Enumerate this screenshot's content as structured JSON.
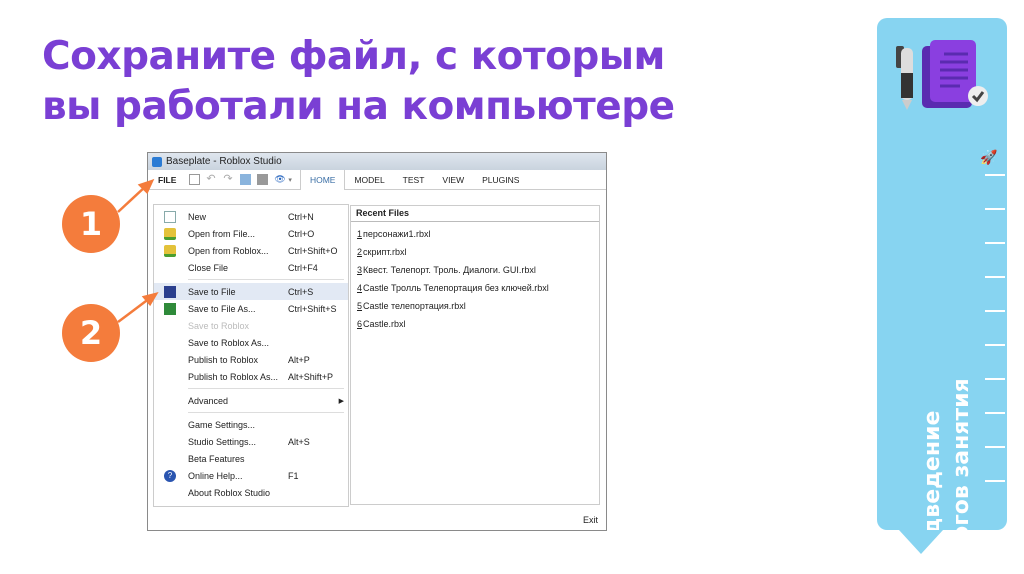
{
  "slide": {
    "title_line1": "Сохраните файл, с которым",
    "title_line2": "вы работали на компьютере",
    "step1": "1",
    "step2": "2"
  },
  "window": {
    "title": "Baseplate - Roblox Studio",
    "ribbon": {
      "file": "FILE",
      "tabs": [
        "HOME",
        "MODEL",
        "TEST",
        "VIEW",
        "PLUGINS"
      ]
    },
    "menu": [
      {
        "label": "New",
        "shortcut": "Ctrl+N",
        "icon": "new-file-icon"
      },
      {
        "label": "Open from File...",
        "shortcut": "Ctrl+O",
        "icon": "open-folder-icon"
      },
      {
        "label": "Open from Roblox...",
        "shortcut": "Ctrl+Shift+O",
        "icon": "open-folder-icon"
      },
      {
        "label": "Close File",
        "shortcut": "Ctrl+F4"
      },
      {
        "label": "Save to File",
        "shortcut": "Ctrl+S",
        "icon": "save-icon"
      },
      {
        "label": "Save to File As...",
        "shortcut": "Ctrl+Shift+S",
        "icon": "save-as-icon"
      },
      {
        "label": "Save to Roblox",
        "shortcut": ""
      },
      {
        "label": "Save to Roblox As...",
        "shortcut": ""
      },
      {
        "label": "Publish to Roblox",
        "shortcut": "Alt+P"
      },
      {
        "label": "Publish to Roblox As...",
        "shortcut": "Alt+Shift+P"
      },
      {
        "label": "Advanced",
        "shortcut": ""
      },
      {
        "label": "Game Settings...",
        "shortcut": ""
      },
      {
        "label": "Studio Settings...",
        "shortcut": "Alt+S"
      },
      {
        "label": "Beta Features",
        "shortcut": ""
      },
      {
        "label": "Online Help...",
        "shortcut": "F1",
        "icon": "help-icon"
      },
      {
        "label": "About Roblox Studio",
        "shortcut": ""
      }
    ],
    "recent": {
      "header": "Recent Files",
      "files": [
        {
          "n": "1",
          "name": "персонажи1.rbxl"
        },
        {
          "n": "2",
          "name": "скрипт.rbxl"
        },
        {
          "n": "3",
          "name": "Квест. Телепорт. Троль. Диалоги. GUI.rbxl"
        },
        {
          "n": "4",
          "name": "Castle Тролль Телепортация без ключей.rbxl"
        },
        {
          "n": "5",
          "name": "Castle телепортация.rbxl"
        },
        {
          "n": "6",
          "name": "Castle.rbxl"
        }
      ]
    },
    "exit": "Exit"
  },
  "sidebar": {
    "line1": "Подведение",
    "line2": "итогов занятия"
  },
  "colors": {
    "title": "#7a3fd4",
    "accent": "#f47c3c",
    "sidebar": "#87d4f1"
  }
}
